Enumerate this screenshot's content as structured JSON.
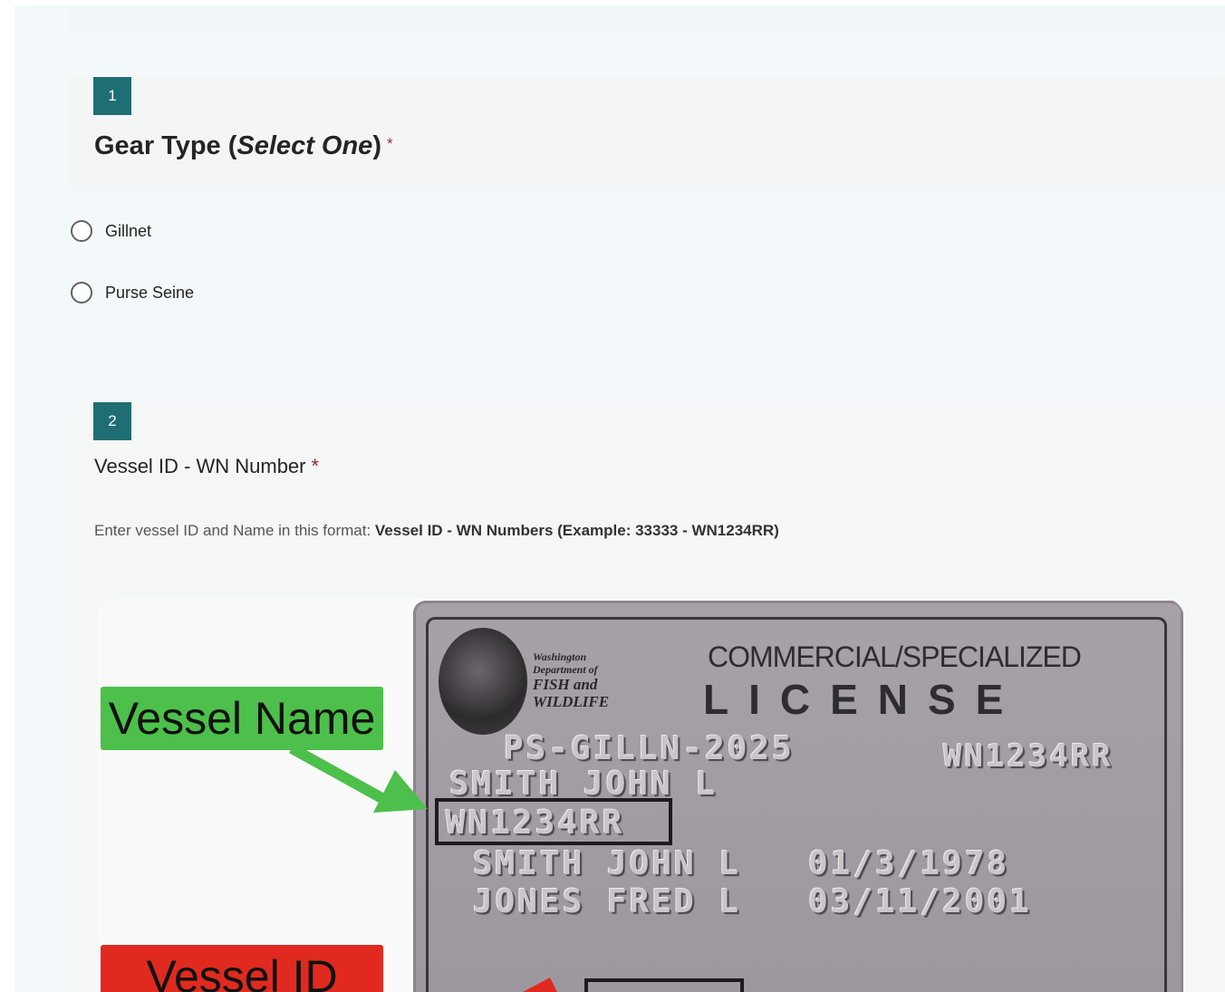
{
  "questions": [
    {
      "number": "1",
      "title_prefix": "Gear Type (",
      "title_emphasis": "Select One",
      "title_suffix": ")",
      "required_mark": "*",
      "options": [
        "Gillnet",
        "Purse Seine"
      ]
    },
    {
      "number": "2",
      "title": "Vessel ID - WN Number",
      "required_mark": "*",
      "description_prefix": "Enter vessel ID and Name in this format: ",
      "description_bold": "Vessel ID - WN Numbers (Example: 33333 - WN1234RR)"
    }
  ],
  "illustration": {
    "callout_vessel_name": "Vessel Name",
    "callout_vessel_id": "Vessel ID",
    "callout_name_color": "#4cc04a",
    "callout_id_color": "#e02a1f",
    "license_card": {
      "seal_lines": [
        "Washington",
        "Department of",
        "FISH and",
        "WILDLIFE"
      ],
      "heading": "COMMERCIAL/SPECIALIZED",
      "license_word": "LICENSE",
      "line_license_type": "PS-GILLN-2025",
      "line_wn_top": "WN1234RR",
      "line_owner": "SMITH JOHN L",
      "line_wn_highlight": "WN1234RR",
      "operators": [
        {
          "name": "SMITH JOHN L",
          "dob": "01/3/1978"
        },
        {
          "name": "JONES FRED L",
          "dob": "03/11/2001"
        }
      ]
    }
  }
}
